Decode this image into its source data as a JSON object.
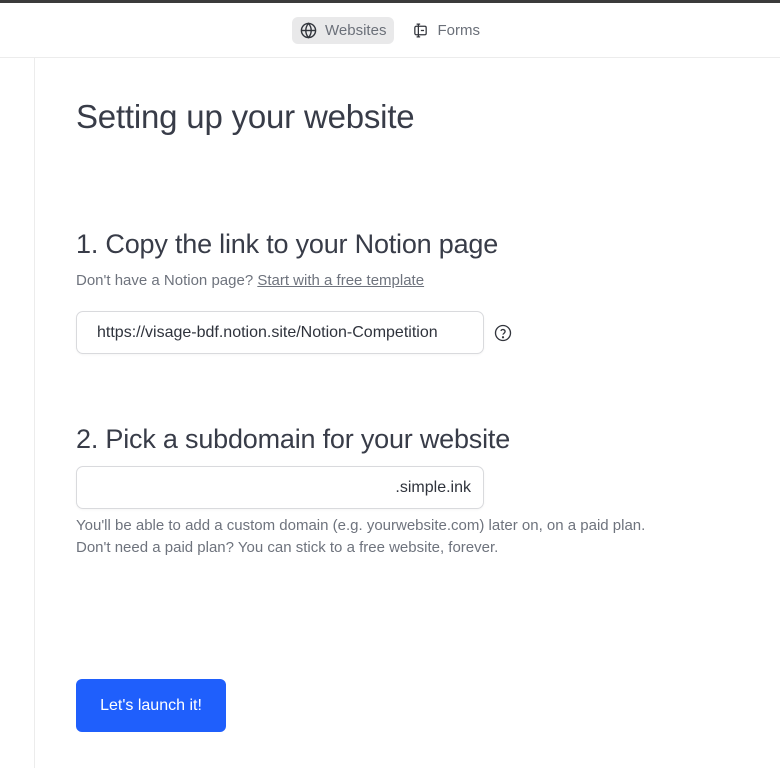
{
  "nav": {
    "tabs": [
      {
        "label": "Websites",
        "icon": "globe-icon",
        "active": true
      },
      {
        "label": "Forms",
        "icon": "form-field-icon",
        "active": false
      }
    ]
  },
  "page": {
    "title": "Setting up your website"
  },
  "step1": {
    "title": "1. Copy the link to your Notion page",
    "subtext_prefix": "Don't have a Notion page? ",
    "template_link": "Start with a free template",
    "url_value": "https://visage-bdf.notion.site/Notion-Competition"
  },
  "step2": {
    "title": "2. Pick a subdomain for your website",
    "subdomain_value": "",
    "suffix": ".simple.ink",
    "help_line1": "You'll be able to add a custom domain (e.g. yourwebsite.com) later on, on a paid plan.",
    "help_line2": "Don't need a paid plan? You can stick to a free website, forever."
  },
  "actions": {
    "launch_label": "Let's launch it!"
  },
  "colors": {
    "accent": "#1f5ffc",
    "title_text": "#383c48",
    "muted_text": "#6e737d"
  }
}
